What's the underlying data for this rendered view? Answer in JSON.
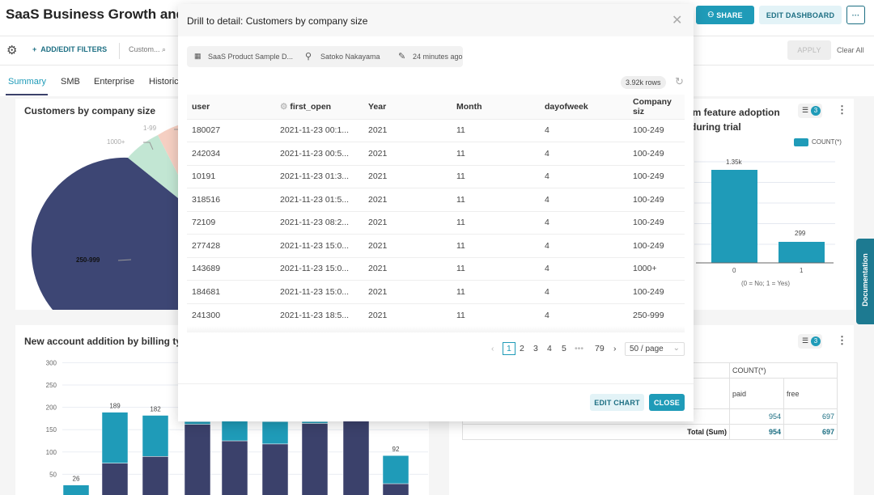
{
  "header": {
    "title": "SaaS Business Growth and Engagement",
    "share": "SHARE",
    "edit_dashboard": "EDIT DASHBOARD",
    "more": "···"
  },
  "filter_bar": {
    "add_edit": "ADD/EDIT FILTERS",
    "filter_chip": "Custom...",
    "apply": "APPLY",
    "clear_all": "Clear All"
  },
  "tabs": [
    {
      "label": "Summary",
      "active": true
    },
    {
      "label": "SMB"
    },
    {
      "label": "Enterprise"
    },
    {
      "label": "Historical"
    }
  ],
  "colors": {
    "accent": "#1f9bb8",
    "navy": "#3b416b",
    "teal": "#1f9bb8"
  },
  "pie_card": {
    "title": "Customers by company size",
    "labels": [
      "1-99",
      "1000+",
      "250-999"
    ]
  },
  "feature_card": {
    "title": "Premium feature adoption during trial",
    "filter_count": "3",
    "legend": "COUNT(*)",
    "xlabel": "(0 = No; 1 = Yes)"
  },
  "billing_card": {
    "title": "New account addition by billing type"
  },
  "pivot_card": {
    "filter_count": "3",
    "metric": "COUNT(*)",
    "cols": [
      "paid",
      "free"
    ],
    "row_values": [
      "954",
      "697"
    ],
    "total_label": "Total (Sum)",
    "totals": [
      "954",
      "697"
    ]
  },
  "chart_data": [
    {
      "type": "bar",
      "title": "Premium feature adoption during trial",
      "categories": [
        "0",
        "1"
      ],
      "values": [
        1350,
        299
      ],
      "data_labels": [
        "1.35k",
        "299"
      ],
      "legend": [
        "COUNT(*)"
      ],
      "xlabel": "(0 = No; 1 = Yes)"
    },
    {
      "type": "bar",
      "stacked": true,
      "title": "New account addition by billing type",
      "ylim": [
        0,
        300
      ],
      "yticks": [
        50,
        100,
        150,
        200,
        250,
        300
      ],
      "totals": [
        26,
        189,
        182,
        168,
        170,
        168,
        168,
        170,
        92
      ],
      "series": [
        {
          "color": "#3b416b",
          "values": [
            0,
            75,
            90,
            162,
            125,
            118,
            164,
            170,
            29
          ]
        },
        {
          "color": "#1f9bb8",
          "values": [
            26,
            114,
            92,
            6,
            45,
            50,
            4,
            0,
            63
          ]
        }
      ],
      "data_labels": [
        "26",
        "189",
        "182",
        "",
        "",
        "",
        "",
        "",
        "92"
      ]
    }
  ],
  "modal": {
    "title": "Drill to detail: Customers by company size",
    "dataset": "SaaS Product Sample D...",
    "owner": "Satoko Nakayama",
    "modified": "24 minutes ago",
    "rows": "3.92k rows",
    "columns": [
      "user",
      "first_open",
      "Year",
      "Month",
      "dayofweek",
      "Company siz"
    ],
    "data": [
      [
        "180027",
        "2021-11-23 00:1...",
        "2021",
        "11",
        "4",
        "100-249"
      ],
      [
        "242034",
        "2021-11-23 00:5...",
        "2021",
        "11",
        "4",
        "100-249"
      ],
      [
        "10191",
        "2021-11-23 01:3...",
        "2021",
        "11",
        "4",
        "100-249"
      ],
      [
        "318516",
        "2021-11-23 01:5...",
        "2021",
        "11",
        "4",
        "100-249"
      ],
      [
        "72109",
        "2021-11-23 08:2...",
        "2021",
        "11",
        "4",
        "100-249"
      ],
      [
        "277428",
        "2021-11-23 15:0...",
        "2021",
        "11",
        "4",
        "100-249"
      ],
      [
        "143689",
        "2021-11-23 15:0...",
        "2021",
        "11",
        "4",
        "1000+"
      ],
      [
        "184681",
        "2021-11-23 15:0...",
        "2021",
        "11",
        "4",
        "100-249"
      ],
      [
        "241300",
        "2021-11-23 18:5...",
        "2021",
        "11",
        "4",
        "250-999"
      ]
    ],
    "pages": [
      "1",
      "2",
      "3",
      "4",
      "5",
      "•••",
      "79"
    ],
    "page_size": "50 / page",
    "edit_chart": "EDIT CHART",
    "close": "CLOSE"
  },
  "documentation": "Documentation"
}
